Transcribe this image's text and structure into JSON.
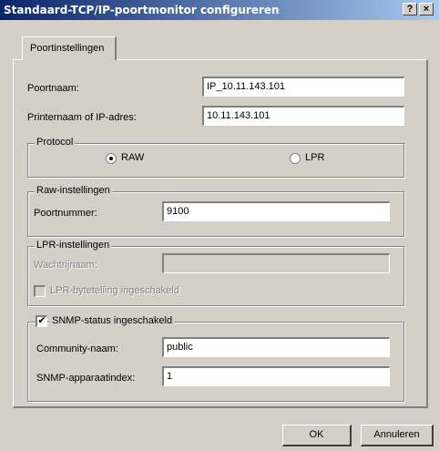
{
  "window": {
    "title": "Standaard-TCP/IP-poortmonitor configureren",
    "help_button": "?",
    "close_button": "×"
  },
  "tab": {
    "label": "Poortinstellingen"
  },
  "fields": {
    "port_name_label": "Poortnaam:",
    "port_name_value": "IP_10.11.143.101",
    "printer_label": "Printernaam of IP-adres:",
    "printer_value": "10.11.143.101"
  },
  "protocol": {
    "legend": "Protocol",
    "raw_label": "RAW",
    "lpr_label": "LPR",
    "selected": "RAW"
  },
  "raw": {
    "legend": "Raw-instellingen",
    "port_number_label": "Poortnummer:",
    "port_number_value": "9100"
  },
  "lpr": {
    "legend": "LPR-instellingen",
    "queue_label": "Wachtrijnaam:",
    "queue_value": "",
    "byte_count_label": "LPR-bytetelling ingeschakeld",
    "byte_count_checked": false
  },
  "snmp": {
    "legend": "SNMP-status ingeschakeld",
    "checked": true,
    "community_label": "Community-naam:",
    "community_value": "public",
    "index_label": "SNMP-apparaatindex:",
    "index_value": "1"
  },
  "buttons": {
    "ok": "OK",
    "cancel": "Annuleren"
  },
  "colors": {
    "face": "#d4d0c8",
    "title_start": "#0a246a",
    "title_end": "#a6caf0"
  }
}
